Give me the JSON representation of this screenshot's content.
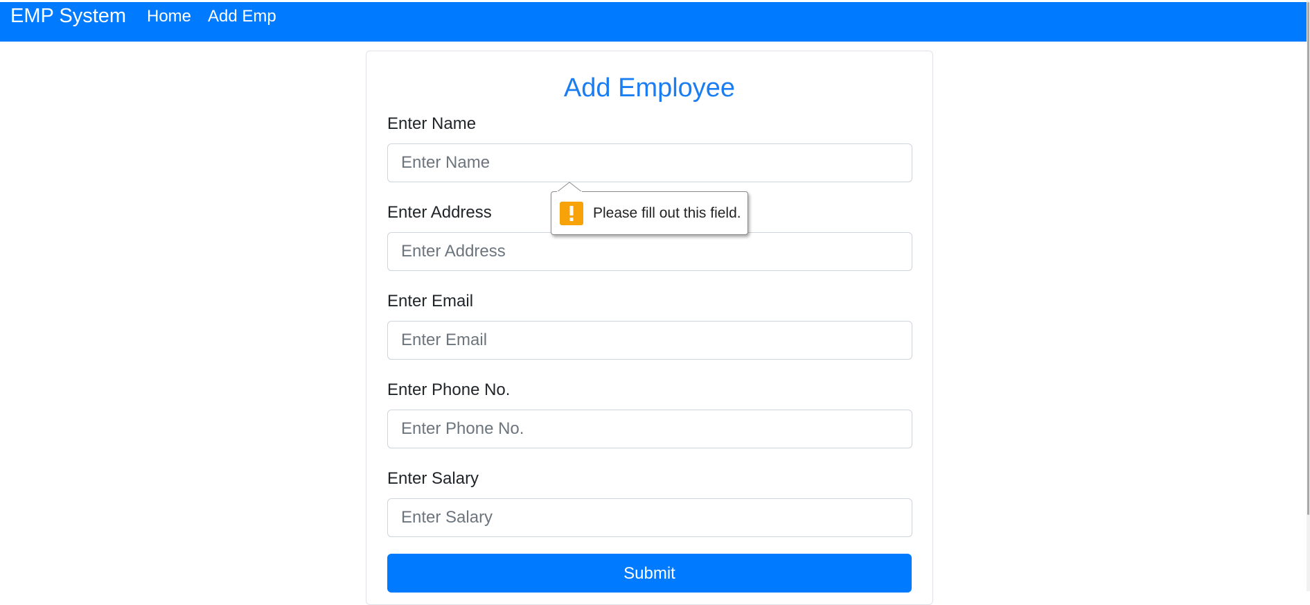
{
  "navbar": {
    "brand": "EMP System",
    "links": [
      "Home",
      "Add Emp"
    ],
    "bg_color": "#007bff"
  },
  "form": {
    "title": "Add Employee",
    "fields": [
      {
        "label": "Enter Name",
        "placeholder": "Enter Name",
        "value": ""
      },
      {
        "label": "Enter Address",
        "placeholder": "Enter Address",
        "value": ""
      },
      {
        "label": "Enter Email",
        "placeholder": "Enter Email",
        "value": ""
      },
      {
        "label": "Enter Phone No.",
        "placeholder": "Enter Phone No.",
        "value": ""
      },
      {
        "label": "Enter Salary",
        "placeholder": "Enter Salary",
        "value": ""
      }
    ],
    "submit_label": "Submit",
    "title_color": "#1a7ef2",
    "button_color": "#007bff"
  },
  "validation_tooltip": {
    "message": "Please fill out this field.",
    "icon": "warning-icon",
    "icon_color": "#f7a208"
  }
}
